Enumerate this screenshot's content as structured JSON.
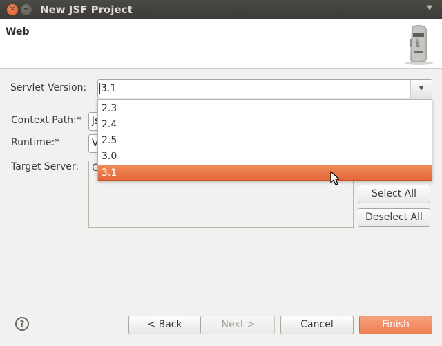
{
  "window": {
    "title": "New JSF Project",
    "menu_icon": "chevron-down-icon"
  },
  "header": {
    "title": "Web",
    "logo_icon": "moai-icon"
  },
  "form": {
    "servlet_version": {
      "label": "Servlet Version:",
      "value": "3.1"
    },
    "context_path": {
      "label": "Context Path:*",
      "value": "js"
    },
    "runtime": {
      "label": "Runtime:*",
      "value": "V"
    },
    "target_server": {
      "label": "Target Server:",
      "value": "C"
    }
  },
  "dropdown": {
    "options": [
      "2.3",
      "2.4",
      "2.5",
      "3.0",
      "3.1"
    ],
    "selected": "3.1"
  },
  "side_buttons": {
    "select_all": "Select All",
    "deselect_all": "Deselect All"
  },
  "footer": {
    "back": "< Back",
    "next": "Next >",
    "cancel": "Cancel",
    "finish": "Finish",
    "help_icon": "help-icon"
  },
  "colors": {
    "accent": "#ef7d52",
    "titlebar": "#3c3b37",
    "background": "#f2f1f0"
  }
}
